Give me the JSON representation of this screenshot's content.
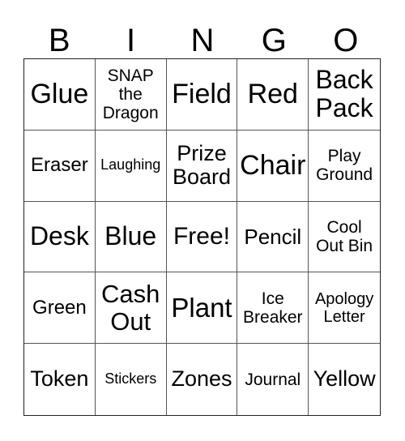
{
  "header": [
    "B",
    "I",
    "N",
    "G",
    "O"
  ],
  "cells": [
    {
      "text": "Glue",
      "size": 34
    },
    {
      "text": "SNAP\nthe\nDragon",
      "size": 21
    },
    {
      "text": "Field",
      "size": 34
    },
    {
      "text": "Red",
      "size": 34
    },
    {
      "text": "Back\nPack",
      "size": 32
    },
    {
      "text": "Eraser",
      "size": 24
    },
    {
      "text": "Laughing",
      "size": 18
    },
    {
      "text": "Prize\nBoard",
      "size": 27
    },
    {
      "text": "Chair",
      "size": 34
    },
    {
      "text": "Play\nGround",
      "size": 21
    },
    {
      "text": "Desk",
      "size": 32
    },
    {
      "text": "Blue",
      "size": 32
    },
    {
      "text": "Free!",
      "size": 30
    },
    {
      "text": "Pencil",
      "size": 26
    },
    {
      "text": "Cool\nOut Bin",
      "size": 21
    },
    {
      "text": "Green",
      "size": 24
    },
    {
      "text": "Cash\nOut",
      "size": 31
    },
    {
      "text": "Plant",
      "size": 33
    },
    {
      "text": "Ice\nBreaker",
      "size": 21
    },
    {
      "text": "Apology\nLetter",
      "size": 20
    },
    {
      "text": "Token",
      "size": 27
    },
    {
      "text": "Stickers",
      "size": 18
    },
    {
      "text": "Zones",
      "size": 27
    },
    {
      "text": "Journal",
      "size": 21
    },
    {
      "text": "Yellow",
      "size": 27
    }
  ]
}
